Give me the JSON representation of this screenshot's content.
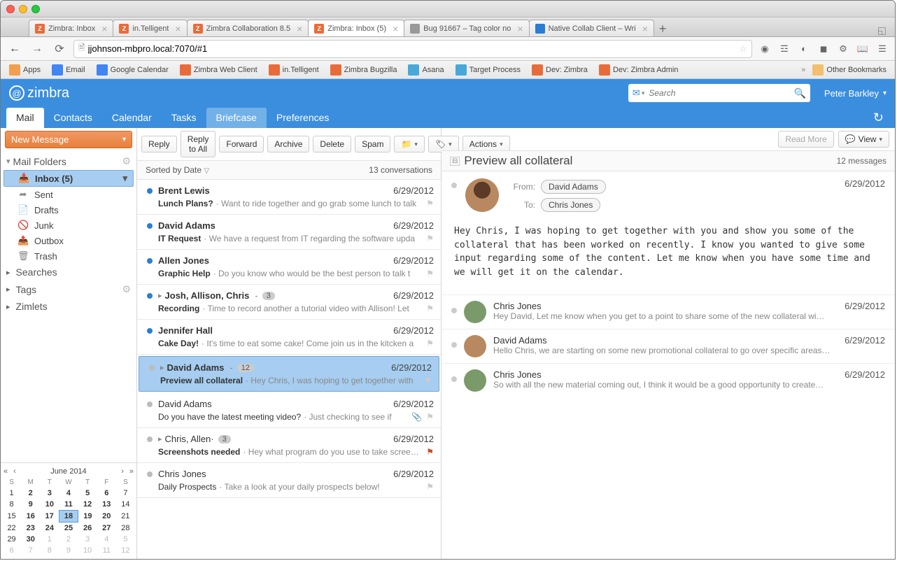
{
  "browser": {
    "tabs": [
      {
        "label": "Zimbra: Inbox",
        "favicon": "z"
      },
      {
        "label": "in.Telligent",
        "favicon": "z"
      },
      {
        "label": "Zimbra Collaboration 8.5",
        "favicon": "z"
      },
      {
        "label": "Zimbra: Inbox (5)",
        "favicon": "z",
        "active": true
      },
      {
        "label": "Bug 91667 – Tag color no",
        "favicon": "grey"
      },
      {
        "label": "Native Collab Client – Wri",
        "favicon": "blue"
      }
    ],
    "url": "jjohnson-mbpro.local:7070/#1",
    "bookmarks": [
      {
        "label": "Apps",
        "icon": "apps"
      },
      {
        "label": "Email",
        "icon": "g"
      },
      {
        "label": "Google Calendar",
        "icon": "g"
      },
      {
        "label": "Zimbra Web Client",
        "icon": "z"
      },
      {
        "label": "in.Telligent",
        "icon": "z"
      },
      {
        "label": "Zimbra Bugzilla",
        "icon": "z"
      },
      {
        "label": "Asana",
        "icon": "a"
      },
      {
        "label": "Target Process",
        "icon": "a"
      },
      {
        "label": "Dev: Zimbra",
        "icon": "z"
      },
      {
        "label": "Dev: Zimbra Admin",
        "icon": "z"
      }
    ],
    "other_bookmarks": "Other Bookmarks"
  },
  "app": {
    "brand": "zimbra",
    "search_placeholder": "Search",
    "user": "Peter Barkley",
    "tabs": [
      {
        "label": "Mail",
        "active": true
      },
      {
        "label": "Contacts"
      },
      {
        "label": "Calendar"
      },
      {
        "label": "Tasks"
      },
      {
        "label": "Briefcase",
        "hover": true
      },
      {
        "label": "Preferences"
      }
    ],
    "new_message": "New Message",
    "folders_header": "Mail Folders",
    "folders": [
      {
        "label": "Inbox (5)",
        "id": "inbox",
        "selected": true
      },
      {
        "label": "Sent",
        "id": "sent"
      },
      {
        "label": "Drafts",
        "id": "drafts"
      },
      {
        "label": "Junk",
        "id": "junk"
      },
      {
        "label": "Outbox",
        "id": "outbox"
      },
      {
        "label": "Trash",
        "id": "trash"
      }
    ],
    "sections": [
      {
        "label": "Searches"
      },
      {
        "label": "Tags",
        "gear": true
      },
      {
        "label": "Zimlets"
      }
    ],
    "minical": {
      "title": "June 2014",
      "dow": [
        "S",
        "M",
        "T",
        "W",
        "T",
        "F",
        "S"
      ],
      "weeks": [
        [
          {
            "n": 1
          },
          {
            "n": 2,
            "b": true
          },
          {
            "n": 3,
            "b": true
          },
          {
            "n": 4,
            "b": true
          },
          {
            "n": 5,
            "b": true
          },
          {
            "n": 6,
            "b": true
          },
          {
            "n": 7
          }
        ],
        [
          {
            "n": 8
          },
          {
            "n": 9,
            "b": true
          },
          {
            "n": 10,
            "b": true
          },
          {
            "n": 11,
            "b": true
          },
          {
            "n": 12,
            "b": true
          },
          {
            "n": 13,
            "b": true
          },
          {
            "n": 14
          }
        ],
        [
          {
            "n": 15
          },
          {
            "n": 16,
            "b": true
          },
          {
            "n": 17,
            "b": true
          },
          {
            "n": 18,
            "b": true,
            "today": true
          },
          {
            "n": 19,
            "b": true
          },
          {
            "n": 20,
            "b": true
          },
          {
            "n": 21
          }
        ],
        [
          {
            "n": 22
          },
          {
            "n": 23,
            "b": true
          },
          {
            "n": 24,
            "b": true
          },
          {
            "n": 25,
            "b": true
          },
          {
            "n": 26,
            "b": true
          },
          {
            "n": 27,
            "b": true
          },
          {
            "n": 28
          }
        ],
        [
          {
            "n": 29
          },
          {
            "n": 30,
            "b": true
          },
          {
            "n": 1,
            "dim": true
          },
          {
            "n": 2,
            "dim": true
          },
          {
            "n": 3,
            "dim": true
          },
          {
            "n": 4,
            "dim": true
          },
          {
            "n": 5,
            "dim": true
          }
        ],
        [
          {
            "n": 6,
            "dim": true
          },
          {
            "n": 7,
            "dim": true
          },
          {
            "n": 8,
            "dim": true
          },
          {
            "n": 9,
            "dim": true
          },
          {
            "n": 10,
            "dim": true
          },
          {
            "n": 11,
            "dim": true
          },
          {
            "n": 12,
            "dim": true
          }
        ]
      ]
    },
    "toolbar": {
      "reply": "Reply",
      "reply_all": "Reply to All",
      "forward": "Forward",
      "archive": "Archive",
      "delete": "Delete",
      "spam": "Spam",
      "actions": "Actions",
      "read_more": "Read More",
      "view": "View"
    },
    "list": {
      "sort": "Sorted by Date",
      "count": "13 conversations",
      "items": [
        {
          "from": "Brent Lewis",
          "subject": "Lunch Plans?",
          "snippet": "· Want to ride together and go grab some lunch to talk",
          "date": "6/29/2012",
          "unread": true
        },
        {
          "from": "David Adams",
          "subject": "IT Request",
          "snippet": "· We have a request from IT regarding the software upda",
          "date": "6/29/2012",
          "unread": true
        },
        {
          "from": "Allen Jones",
          "subject": "Graphic Help",
          "snippet": "· Do you know who would be the best person to talk t",
          "date": "6/29/2012",
          "unread": true
        },
        {
          "from": "Josh, Allison, Chris",
          "subject": "Recording",
          "snippet": "· Time to record another a tutorial video with Allison! Let",
          "date": "6/29/2012",
          "unread": true,
          "disclose": true,
          "count": "3",
          "dash": true
        },
        {
          "from": "Jennifer Hall",
          "subject": "Cake Day!",
          "snippet": "· It's time to eat some cake! Come join us in the kitcken a",
          "date": "6/29/2012",
          "unread": true
        },
        {
          "from": "David Adams",
          "subject": "Preview all collateral",
          "snippet": "· Hey Chris, I was hoping to get together with",
          "date": "6/29/2012",
          "selected": true,
          "disclose": true,
          "count": "12",
          "dash": true
        },
        {
          "from": "David Adams",
          "subject": "Do you have the latest meeting video?",
          "snippet": "· Just checking to see if",
          "date": "6/29/2012",
          "subj_normal": true,
          "attach": true,
          "from_normal": true
        },
        {
          "from": "Chris, Allen·",
          "subject": "Screenshots needed",
          "snippet": "· Hey what program do you use to take screensh",
          "date": "6/29/2012",
          "disclose": true,
          "count": "3",
          "flag_on": true,
          "from_normal": true
        },
        {
          "from": "Chris Jones",
          "subject": "Daily Prospects",
          "snippet": "· Take a look at your daily prospects below!",
          "date": "6/29/2012",
          "from_normal": true,
          "subj_normal": true
        }
      ]
    },
    "reading": {
      "title": "Preview all collateral",
      "count": "12 messages",
      "from": "David Adams",
      "to": "Chris Jones",
      "from_label": "From:",
      "to_label": "To:",
      "date": "6/29/2012",
      "body": "Hey Chris, I was hoping to get together with you and show you some of the collateral that has been worked on recently. I know you wanted to give some input regarding some of the content. Let me know when you have some time and we will get it on the calendar.",
      "replies": [
        {
          "name": "Chris Jones",
          "snippet": "Hey David, Let me know when you get to a point to share some of the new collateral wi…",
          "date": "6/29/2012",
          "avatar": "a"
        },
        {
          "name": "David Adams",
          "snippet": "Hello Chris, we are starting on some new promotional collateral to go over specific areas…",
          "date": "6/29/2012",
          "avatar": "b"
        },
        {
          "name": "Chris Jones",
          "snippet": "So with all the new material coming out, I think it would be a good opportunity to create…",
          "date": "6/29/2012",
          "avatar": "a"
        }
      ]
    }
  }
}
